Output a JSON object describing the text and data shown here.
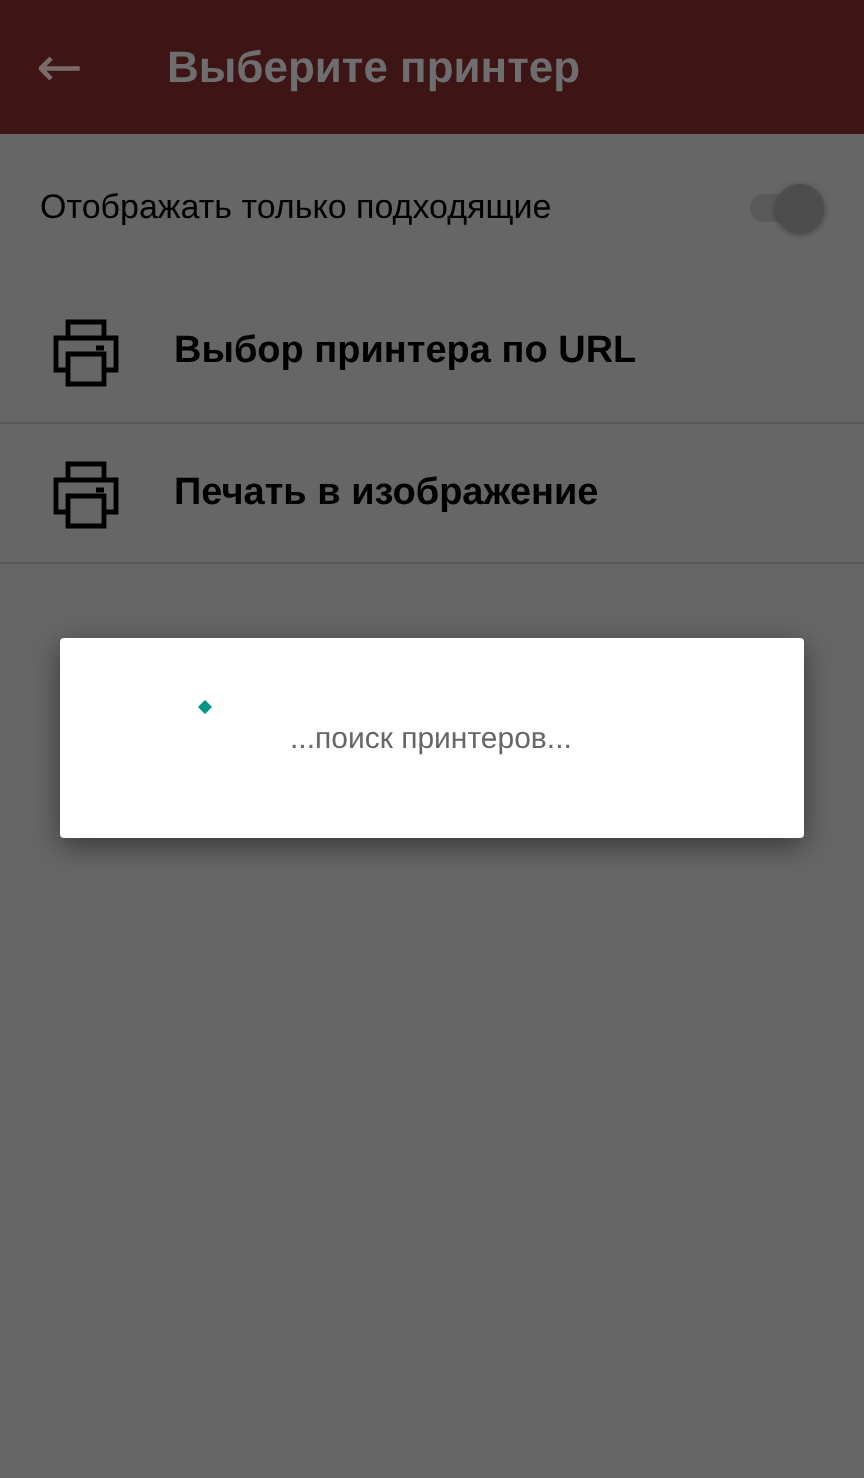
{
  "app_bar": {
    "back_icon": "←",
    "title": "Выберите принтер"
  },
  "filter": {
    "label": "Отображать только подходящие",
    "on": true
  },
  "printers": [
    {
      "label": "Выбор принтера по URL"
    },
    {
      "label": "Печать в изображение"
    }
  ],
  "dialog": {
    "message": "...поиск принтеров..."
  }
}
